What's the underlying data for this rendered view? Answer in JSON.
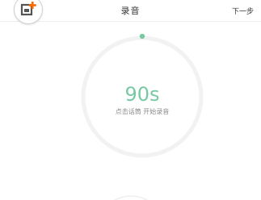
{
  "header": {
    "title": "录音",
    "next_label": "下一步"
  },
  "add_button": {
    "icon": "add-image-icon",
    "accent_color": "#ff6a00"
  },
  "recorder": {
    "timer": "90s",
    "hint": "点击话筒 开始录音",
    "timer_color": "#78c9a3",
    "ring_color": "#f2f2f2",
    "indicator_color": "#78c9a3"
  }
}
